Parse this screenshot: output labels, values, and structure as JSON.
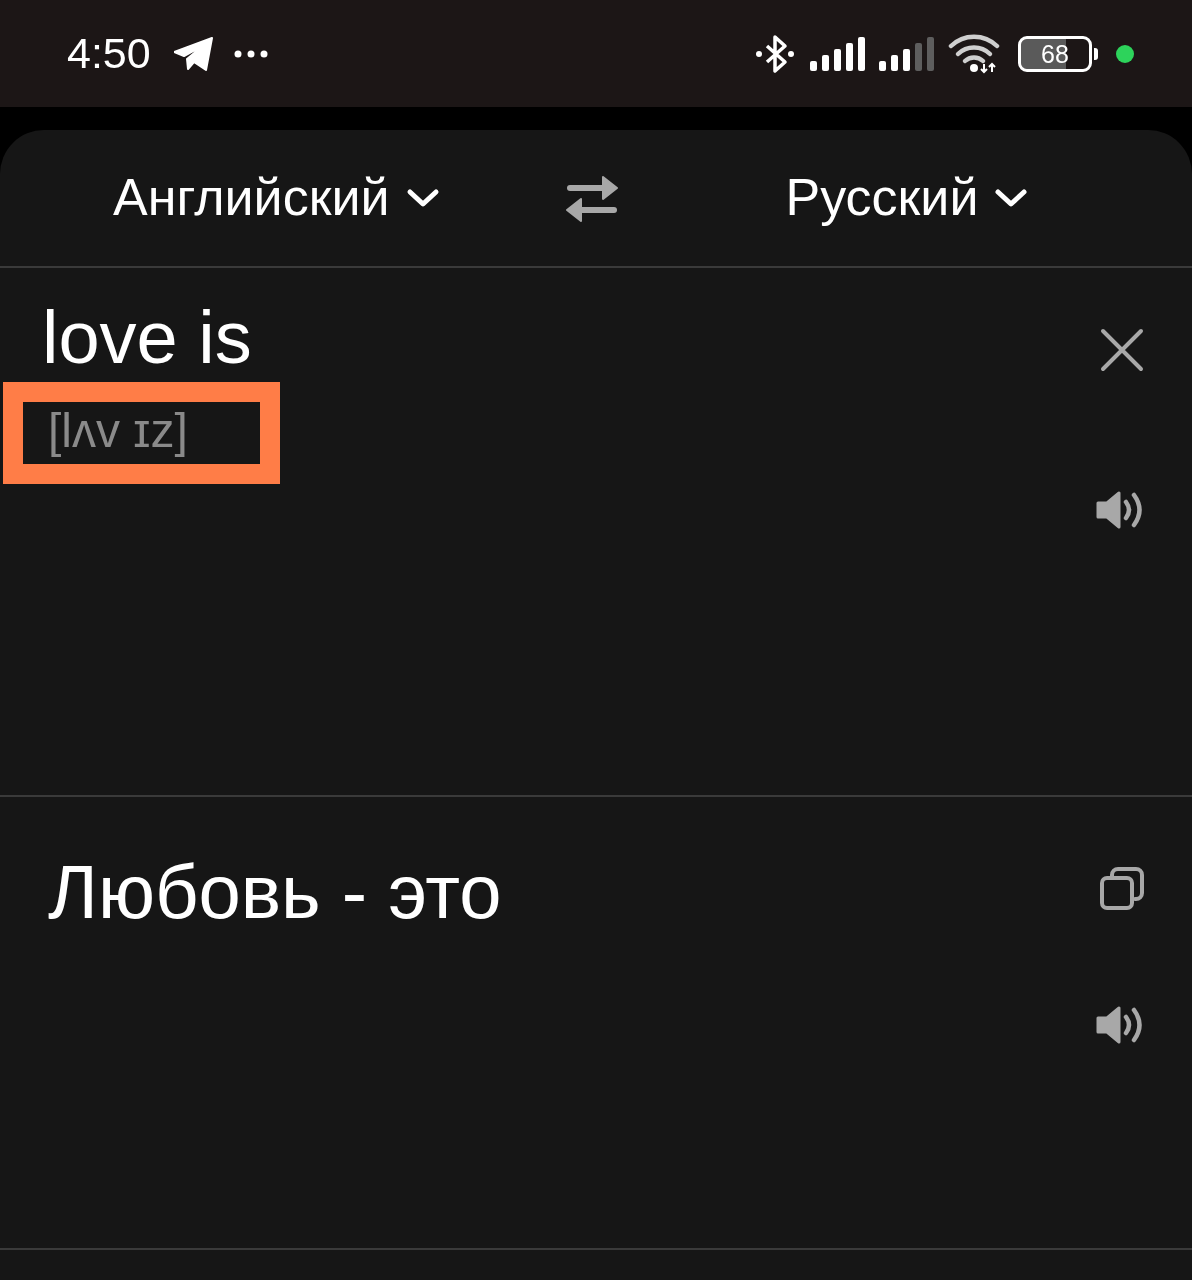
{
  "status_bar": {
    "time": "4:50",
    "battery": "68"
  },
  "language_bar": {
    "source_language": "Английский",
    "target_language": "Русский"
  },
  "source": {
    "text": "love is",
    "transcription": "[lʌv ɪz]",
    "transcription_highlighted": true
  },
  "translation": {
    "text": "Любовь - это"
  }
}
